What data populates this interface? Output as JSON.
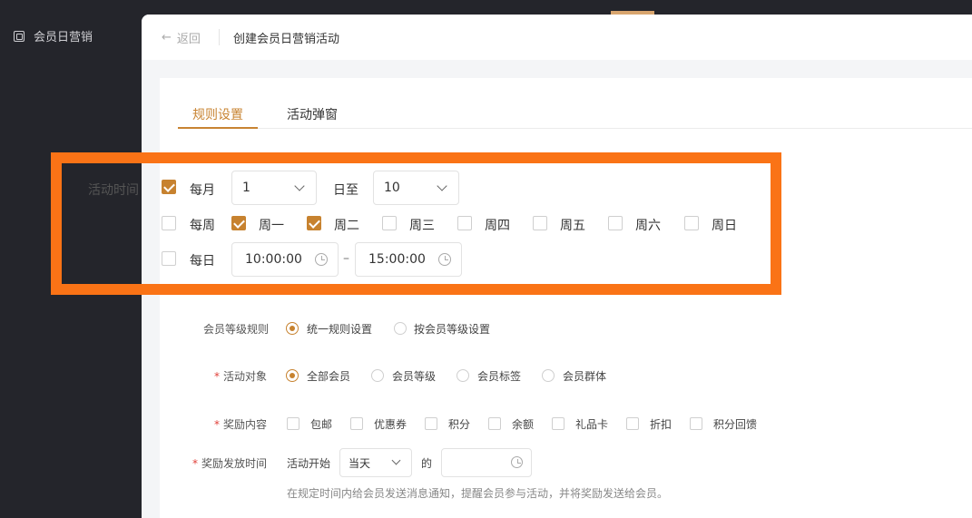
{
  "sidebar": {
    "item_label": "会员日营销"
  },
  "header": {
    "back_label": "返回",
    "title": "创建会员日营销活动"
  },
  "tabs": [
    {
      "label": "规则设置",
      "active": true
    },
    {
      "label": "活动弹窗",
      "active": false
    }
  ],
  "activity_time": {
    "label": "活动时间",
    "monthly": {
      "label": "每月",
      "checked": true,
      "from": "1",
      "to_label": "日至",
      "to": "10"
    },
    "weekly": {
      "label": "每周",
      "checked": false,
      "days": [
        {
          "label": "周一",
          "checked": true
        },
        {
          "label": "周二",
          "checked": true
        },
        {
          "label": "周三",
          "checked": false
        },
        {
          "label": "周四",
          "checked": false
        },
        {
          "label": "周五",
          "checked": false
        },
        {
          "label": "周六",
          "checked": false
        },
        {
          "label": "周日",
          "checked": false
        }
      ]
    },
    "daily": {
      "label": "每日",
      "checked": false,
      "start": "10:00:00",
      "separator": "–",
      "end": "15:00:00"
    }
  },
  "member_level_rule": {
    "label": "会员等级规则",
    "options": [
      {
        "label": "统一规则设置",
        "checked": true
      },
      {
        "label": "按会员等级设置",
        "checked": false
      }
    ]
  },
  "target": {
    "label": "活动对象",
    "required": true,
    "options": [
      {
        "label": "全部会员",
        "checked": true
      },
      {
        "label": "会员等级",
        "checked": false
      },
      {
        "label": "会员标签",
        "checked": false
      },
      {
        "label": "会员群体",
        "checked": false
      }
    ]
  },
  "reward_content": {
    "label": "奖励内容",
    "required": true,
    "options": [
      {
        "label": "包邮",
        "checked": false
      },
      {
        "label": "优惠券",
        "checked": false
      },
      {
        "label": "积分",
        "checked": false
      },
      {
        "label": "余额",
        "checked": false
      },
      {
        "label": "礼品卡",
        "checked": false
      },
      {
        "label": "折扣",
        "checked": false
      },
      {
        "label": "积分回馈",
        "checked": false
      }
    ]
  },
  "reward_time": {
    "label": "奖励发放时间",
    "required": true,
    "prefix": "活动开始",
    "select_value": "当天",
    "suffix": "的",
    "time_value": "",
    "hint": "在规定时间内给会员发送消息通知，提醒会员参与活动，并将奖励发送给会员。"
  },
  "colors": {
    "accent": "#c7822f",
    "highlight": "#fa7316",
    "sidebar": "#24252b"
  }
}
